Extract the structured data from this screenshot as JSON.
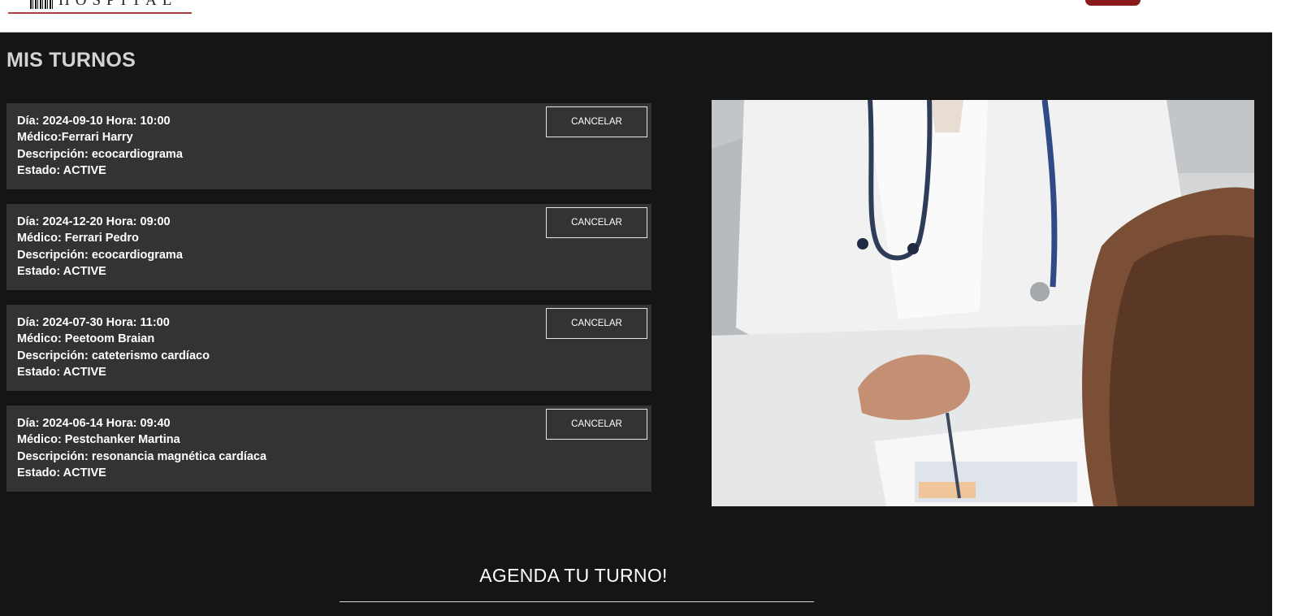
{
  "header": {
    "logo_text": "HOSPITAL",
    "brand_color": "#8b1a1a",
    "accent_line_color": "#b23b3b"
  },
  "page_title": "MIS TURNOS",
  "appointments": [
    {
      "line1": "Día: 2024-09-10 Hora: 10:00",
      "line2": "Médico:Ferrari Harry",
      "line3": "Descripción: ecocardiograma",
      "line4": "Estado: ACTIVE",
      "button": "CANCELAR"
    },
    {
      "line1": "Día: 2024-12-20 Hora: 09:00",
      "line2": "Médico: Ferrari Pedro",
      "line3": "Descripción: ecocardiograma",
      "line4": "Estado: ACTIVE",
      "button": "CANCELAR"
    },
    {
      "line1": "Día: 2024-07-30 Hora: 11:00",
      "line2": "Médico: Peetoom Braian",
      "line3": "Descripción: cateterismo cardíaco",
      "line4": "Estado: ACTIVE",
      "button": "CANCELAR"
    },
    {
      "line1": "Día: 2024-06-14 Hora: 09:40",
      "line2": "Médico: Pestchanker Martina",
      "line3": "Descripción: resonancia magnética cardíaca",
      "line4": "Estado: ACTIVE",
      "button": "CANCELAR"
    }
  ],
  "agenda": {
    "title": "AGENDA TU TURNO!"
  },
  "colors": {
    "page_background": "#151515",
    "card_background": "#333333",
    "title_text": "#d3d3d3"
  }
}
